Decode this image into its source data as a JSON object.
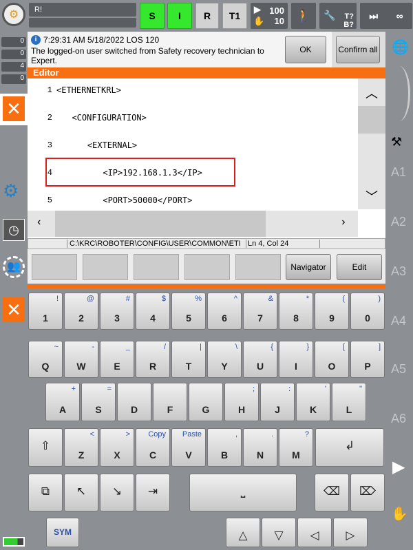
{
  "topbar": {
    "program_field": "R!",
    "status_s": "S",
    "status_i": "I",
    "status_r": "R",
    "mode": "T1",
    "override_program": "100",
    "override_jog": "10",
    "tool_label": "T?",
    "base_label": "B?",
    "increment": "∞"
  },
  "sidebar_counts": {
    "ack": "0",
    "state": "0",
    "info": "4",
    "wait": "0"
  },
  "message": {
    "timestamp": "7:29:31 AM 5/18/2022 LOS 120",
    "text": "The logged-on user switched from Safety recovery technician to Expert.",
    "ok_label": "OK",
    "confirm_all_label": "Confirm all"
  },
  "editor": {
    "title": "Editor",
    "lines": [
      {
        "num": "1",
        "code": "<ETHERNETKRL>"
      },
      {
        "num": "2",
        "code": "  <CONFIGURATION>"
      },
      {
        "num": "3",
        "code": "    <EXTERNAL>"
      },
      {
        "num": "4",
        "code": "      <IP>192.168.1.3</IP>"
      },
      {
        "num": "5",
        "code": "      <PORT>50000</PORT>"
      }
    ],
    "highlight_color": "#e21b1b",
    "path": "C:\\KRC\\ROBOTER\\CONFIG\\USER\\COMMON\\ETI",
    "position": "Ln 4, Col 24"
  },
  "softkeys": {
    "navigator": "Navigator",
    "edit": "Edit"
  },
  "axes": [
    "A1",
    "A2",
    "A3",
    "A4",
    "A5",
    "A6"
  ],
  "keyboard": {
    "row1": [
      [
        "1",
        "!"
      ],
      [
        "2",
        "@"
      ],
      [
        "3",
        "#"
      ],
      [
        "4",
        "$"
      ],
      [
        "5",
        "%"
      ],
      [
        "6",
        "^"
      ],
      [
        "7",
        "&"
      ],
      [
        "8",
        "*"
      ],
      [
        "9",
        "("
      ],
      [
        "0",
        ")"
      ]
    ],
    "row2": [
      [
        "Q",
        "~"
      ],
      [
        "W",
        "-"
      ],
      [
        "E",
        "_"
      ],
      [
        "R",
        "/"
      ],
      [
        "T",
        "|"
      ],
      [
        "Y",
        "\\"
      ],
      [
        "U",
        "{"
      ],
      [
        "I",
        "}"
      ],
      [
        "O",
        "["
      ],
      [
        "P",
        "]"
      ]
    ],
    "row3": [
      [
        "A",
        "+"
      ],
      [
        "S",
        "="
      ],
      [
        "D",
        ""
      ],
      [
        "F",
        ""
      ],
      [
        "G",
        ""
      ],
      [
        "H",
        ";"
      ],
      [
        "J",
        ":"
      ],
      [
        "K",
        "'"
      ],
      [
        "L",
        "\""
      ]
    ],
    "row4": [
      [
        "Z",
        "<"
      ],
      [
        "X",
        ">"
      ],
      [
        "C",
        "Copy"
      ],
      [
        "V",
        "Paste"
      ],
      [
        "B",
        ","
      ],
      [
        "N",
        "."
      ],
      [
        "M",
        "?"
      ]
    ],
    "sym": "SYM"
  },
  "colors": {
    "accent": "#f76f10",
    "active_green": "#35e82e",
    "close": "#f76f10"
  }
}
